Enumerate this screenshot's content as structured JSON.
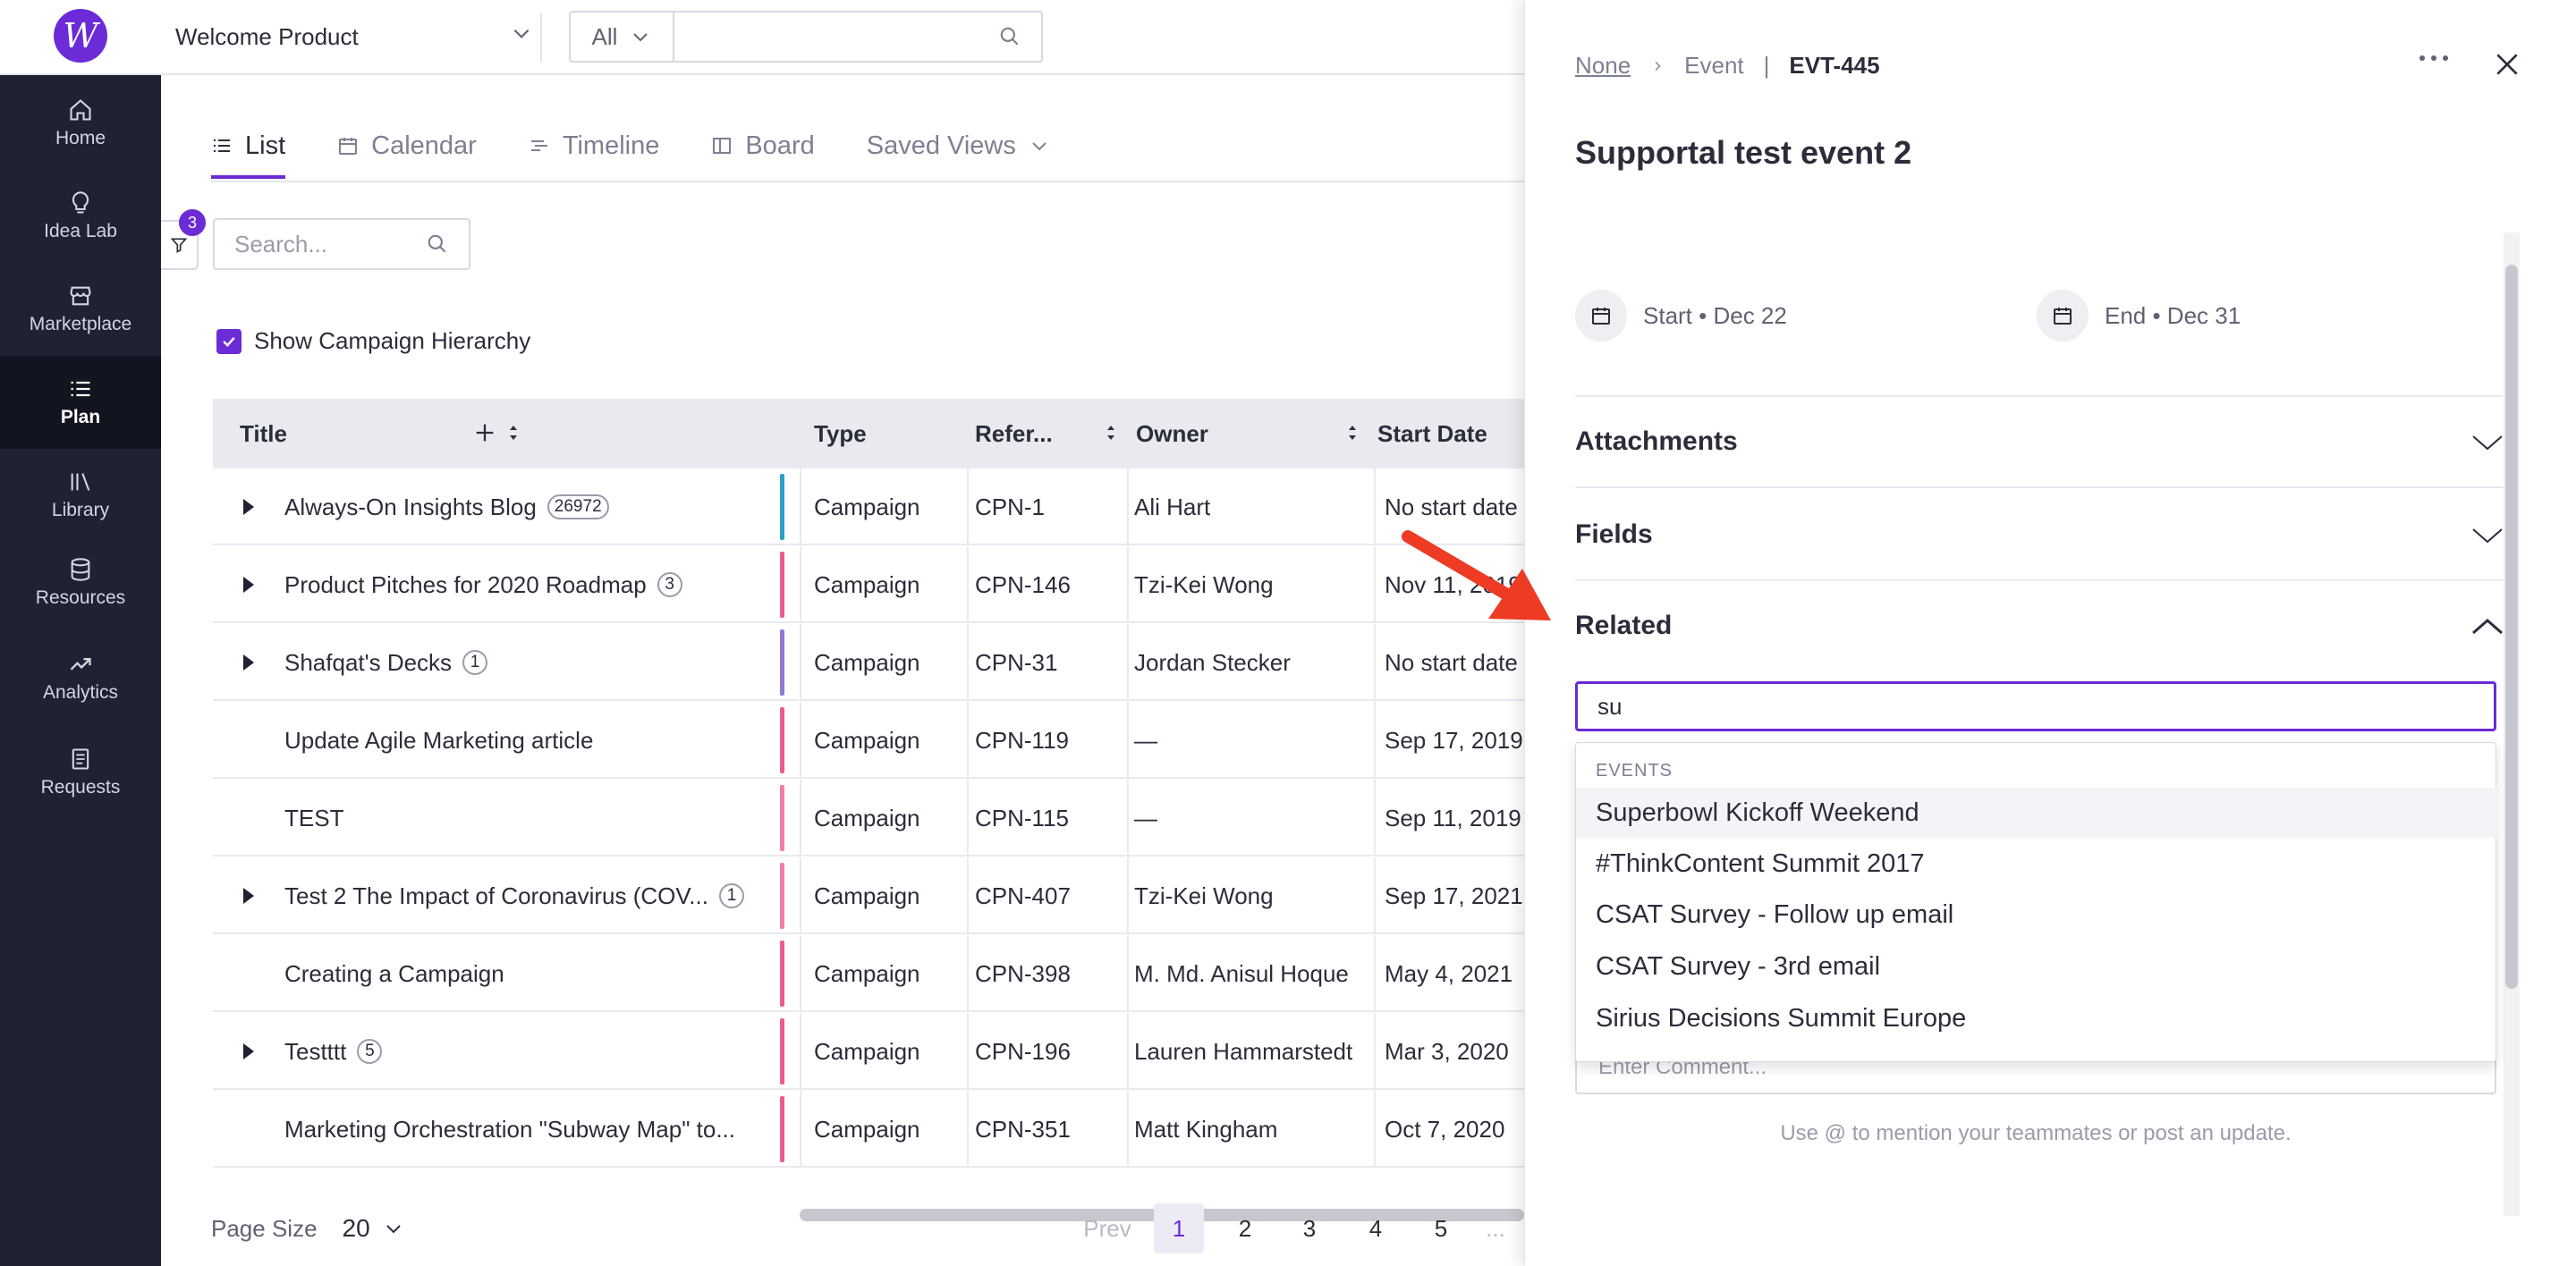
{
  "topbar": {
    "product": "Welcome Product",
    "search_scope": "All",
    "search_value": ""
  },
  "sidebar": {
    "items": [
      {
        "label": "Home",
        "icon": "home-icon"
      },
      {
        "label": "Idea Lab",
        "icon": "lightbulb-icon"
      },
      {
        "label": "Marketplace",
        "icon": "storefront-icon"
      },
      {
        "label": "Plan",
        "icon": "list-icon"
      },
      {
        "label": "Library",
        "icon": "library-icon"
      },
      {
        "label": "Resources",
        "icon": "database-icon"
      },
      {
        "label": "Analytics",
        "icon": "trend-icon"
      },
      {
        "label": "Requests",
        "icon": "document-icon"
      }
    ]
  },
  "main": {
    "tabs": [
      {
        "label": "List"
      },
      {
        "label": "Calendar"
      },
      {
        "label": "Timeline"
      },
      {
        "label": "Board"
      },
      {
        "label": "Saved Views"
      }
    ],
    "filter_count": "3",
    "search_placeholder": "Search...",
    "hierarchy_label": "Show Campaign Hierarchy",
    "columns": {
      "title": "Title",
      "type": "Type",
      "reference": "Refer...",
      "owner": "Owner",
      "start": "Start Date"
    },
    "rows": [
      {
        "title": "Always-On Insights Blog",
        "count": "26972",
        "expand": true,
        "color": "#2f9fc8",
        "type": "Campaign",
        "ref": "CPN-1",
        "owner": "Ali Hart",
        "start": "No start date"
      },
      {
        "title": "Product Pitches for 2020 Roadmap",
        "count": "3",
        "expand": true,
        "color": "#ea5b8f",
        "type": "Campaign",
        "ref": "CPN-146",
        "owner": "Tzi-Kei Wong",
        "start": "Nov 11, 2019"
      },
      {
        "title": "Shafqat's Decks",
        "count": "1",
        "expand": true,
        "color": "#8f7bd0",
        "type": "Campaign",
        "ref": "CPN-31",
        "owner": "Jordan Stecker",
        "start": "No start date"
      },
      {
        "title": "Update Agile Marketing article",
        "count": "",
        "expand": false,
        "color": "#ea5b8f",
        "type": "Campaign",
        "ref": "CPN-119",
        "owner": "—",
        "start": "Sep 17, 2019"
      },
      {
        "title": "TEST",
        "count": "",
        "expand": false,
        "color": "#f17da8",
        "type": "Campaign",
        "ref": "CPN-115",
        "owner": "—",
        "start": "Sep 11, 2019"
      },
      {
        "title": "Test 2 The Impact of Coronavirus (COV...",
        "count": "1",
        "expand": true,
        "color": "#f17da8",
        "type": "Campaign",
        "ref": "CPN-407",
        "owner": "Tzi-Kei Wong",
        "start": "Sep 17, 2021"
      },
      {
        "title": "Creating a Campaign",
        "count": "",
        "expand": false,
        "color": "#ea5b8f",
        "type": "Campaign",
        "ref": "CPN-398",
        "owner": "M. Md. Anisul Hoque",
        "start": "May 4, 2021"
      },
      {
        "title": "Testttt",
        "count": "5",
        "expand": true,
        "color": "#ea5b8f",
        "type": "Campaign",
        "ref": "CPN-196",
        "owner": "Lauren Hammarstedt",
        "start": "Mar 3, 2020"
      },
      {
        "title": "Marketing Orchestration \"Subway Map\" to...",
        "count": "",
        "expand": false,
        "color": "#ea5b8f",
        "type": "Campaign",
        "ref": "CPN-351",
        "owner": "Matt Kingham",
        "start": "Oct 7, 2020"
      }
    ],
    "pager": {
      "page_size_label": "Page Size",
      "page_size": "20",
      "prev": "Prev",
      "pages": [
        "1",
        "2",
        "3",
        "4",
        "5"
      ],
      "ellipsis": "...",
      "current": "1"
    }
  },
  "panel": {
    "crumb_parent": "None",
    "crumb_type": "Event",
    "crumb_sep": "|",
    "crumb_code": "EVT-445",
    "title": "Supportal test event 2",
    "start": "Start • Dec 22",
    "end": "End • Dec 31",
    "sections": {
      "attachments": "Attachments",
      "fields": "Fields",
      "related": "Related"
    },
    "related_query": "su",
    "dropdown_heading": "EVENTS",
    "dropdown_items": [
      "Superbowl Kickoff Weekend",
      "#ThinkContent Summit 2017",
      "CSAT Survey - Follow up email",
      "CSAT Survey - 3rd email",
      "Sirius Decisions Summit Europe"
    ],
    "comment_placeholder": "Enter Comment...",
    "hint": "Use @ to mention your teammates or post an update."
  },
  "colors": {
    "accent": "#6b2bd6",
    "sidebar": "#1f2233",
    "arrow": "#ee3b24"
  }
}
